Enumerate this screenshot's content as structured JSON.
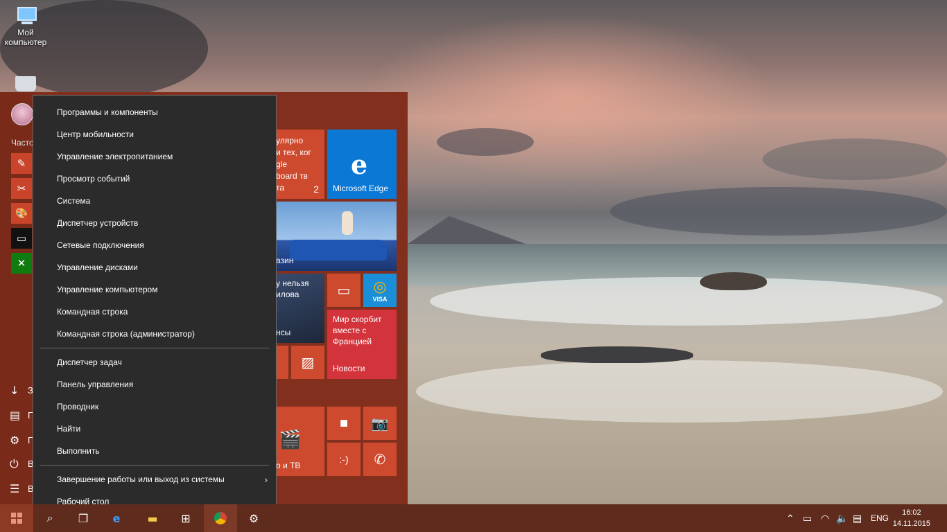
{
  "desktop": {
    "icons": [
      {
        "label": "Мой компьютер",
        "icon": "computer-icon"
      },
      {
        "label": "",
        "icon": "recycle-bin-icon"
      }
    ]
  },
  "start_menu": {
    "frequent_label": "Часто",
    "frequent_apps": [
      {
        "icon": "notepad-icon"
      },
      {
        "icon": "snipping-tool-icon"
      },
      {
        "icon": "paint-icon"
      },
      {
        "icon": "cmd-icon"
      },
      {
        "icon": "xbox-icon"
      }
    ],
    "side_items": [
      {
        "icon": "download-icon",
        "letter": "З"
      },
      {
        "icon": "explorer-icon",
        "letter": "П"
      },
      {
        "icon": "settings-icon",
        "letter": "П"
      },
      {
        "icon": "power-icon",
        "letter": "В"
      },
      {
        "icon": "all-apps-icon",
        "letter": "В"
      }
    ],
    "tiles": {
      "store_text": "улярно\nи тех, ког\ngle\nboard тв\nта",
      "store_badge": "2",
      "edge_label": "Microsoft Edge",
      "photo_caption": "азин",
      "news2_text": "у нельзя\nилова",
      "news2_caption": "нсы",
      "news_headline": "Мир скорбит вместе с Францией",
      "news_label": "Новости",
      "movies_label": "о и ТВ",
      "visa_label": "VISA"
    }
  },
  "context_menu": {
    "group1": [
      "Программы и компоненты",
      "Центр мобильности",
      "Управление электропитанием",
      "Просмотр событий",
      "Система",
      "Диспетчер устройств",
      "Сетевые подключения",
      "Управление дисками",
      "Управление компьютером",
      "Командная строка",
      "Командная строка (администратор)"
    ],
    "group2": [
      "Диспетчер задач",
      "Панель управления",
      "Проводник",
      "Найти",
      "Выполнить"
    ],
    "group3": [
      "Завершение работы или выход из системы",
      "Рабочий стол"
    ]
  },
  "taskbar": {
    "apps": [
      "search-icon",
      "task-view-icon",
      "edge-icon",
      "file-explorer-icon",
      "store-icon",
      "chrome-icon",
      "settings-icon"
    ],
    "tray": {
      "language": "ENG",
      "time": "16:02",
      "date": "14.11.2015"
    }
  },
  "colors": {
    "accent": "#832f1d",
    "context_bg": "#2b2b2b",
    "edge_blue": "#0a78d4",
    "news_red": "#d3333a"
  }
}
